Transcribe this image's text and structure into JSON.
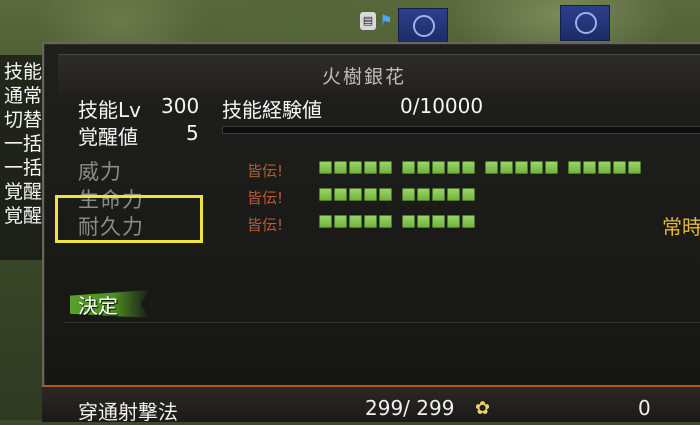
{
  "hud": {
    "icon_left": "▤",
    "icon_right": "⚑"
  },
  "left_list": {
    "header": "技能",
    "items": [
      "通常",
      "切替",
      "一括",
      "一括",
      "覚醒",
      "覚醒"
    ]
  },
  "dialog": {
    "title": "火樹銀花",
    "skill_level_label": "技能Lv",
    "skill_level_value": "300",
    "skill_exp_label": "技能経験値",
    "skill_exp_value": "0/10000",
    "awaken_label": "覚醒値",
    "awaken_value": "5",
    "stats": [
      {
        "label": "威力",
        "tag": "皆伝!",
        "segments": [
          5,
          5,
          5,
          5
        ]
      },
      {
        "label": "生命力",
        "tag": "皆伝!",
        "segments": [
          5,
          5
        ]
      },
      {
        "label": "耐久力",
        "tag": "皆伝!",
        "segments": [
          5,
          5
        ]
      }
    ],
    "right_clipped_text": "常時",
    "confirm_label": "決定"
  },
  "bottom_row": {
    "name": "穿通射撃法",
    "count": "299/ 299",
    "value": "0"
  },
  "colors": {
    "highlight": "#f2e33a",
    "segment": "#8ccc5a",
    "tag": "#b85a3a",
    "accent_orange": "#e8b63a"
  }
}
